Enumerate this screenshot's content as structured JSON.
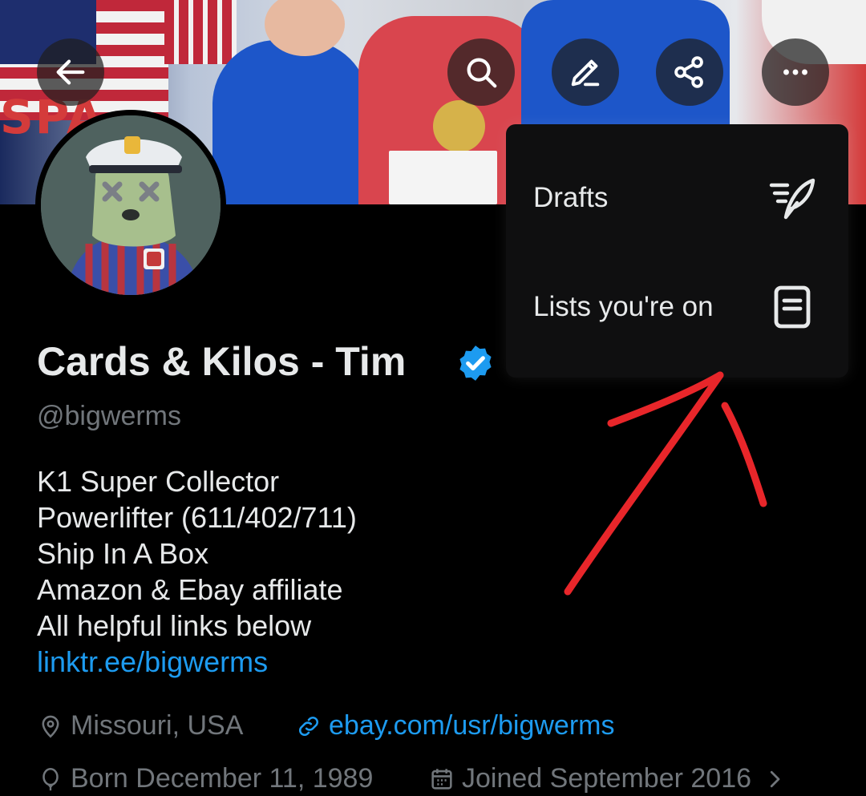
{
  "header": {
    "back_icon": "arrow-left-icon",
    "search_icon": "search-icon",
    "edit_icon": "pencil-icon",
    "share_icon": "share-icon",
    "more_icon": "more-horizontal-icon"
  },
  "profile": {
    "name": "Cards & Kilos - Tim",
    "verified": true,
    "handle": "@bigwerms",
    "bio_lines": [
      "K1 Super Collector",
      "Powerlifter (611/402/711)",
      "Ship In A Box",
      "Amazon & Ebay affiliate",
      "All helpful links below"
    ],
    "bio_link": "linktr.ee/bigwerms",
    "location": "Missouri, USA",
    "website": "ebay.com/usr/bigwerms",
    "born": "Born December 11, 1989",
    "joined": "Joined September 2016"
  },
  "menu": {
    "items": [
      {
        "label": "Drafts",
        "icon": "drafts-feather-icon"
      },
      {
        "label": "Lists you're on",
        "icon": "list-document-icon"
      }
    ]
  },
  "colors": {
    "accent": "#1d9bf0",
    "annotation": "#e8262a",
    "muted": "#71767b",
    "text": "#e7e9ea"
  }
}
